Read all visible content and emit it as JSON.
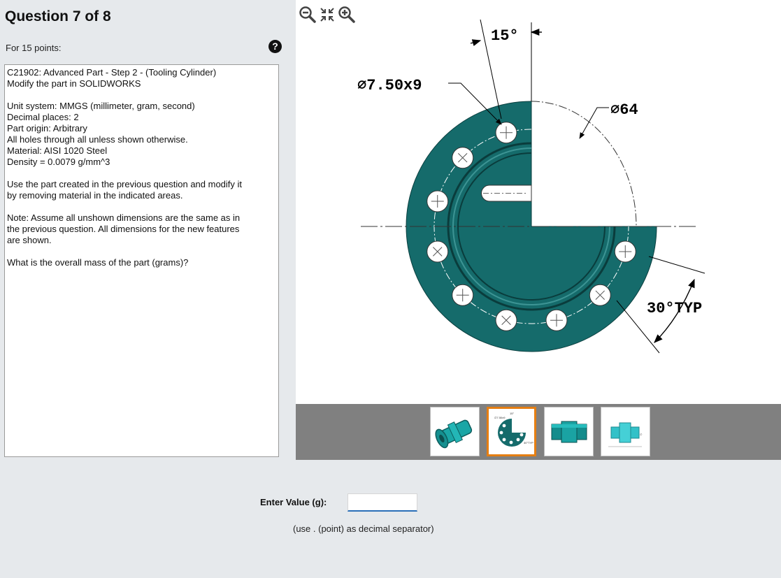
{
  "header": {
    "title": "Question 7 of 8",
    "points": "For 15 points:",
    "help_icon": "question-circle-icon"
  },
  "description": {
    "lines": [
      "C21902:  Advanced Part - Step 2 - (Tooling Cylinder)",
      "Modify the part in SOLIDWORKS",
      "",
      "Unit system: MMGS (millimeter, gram, second)",
      "Decimal places: 2",
      "Part origin: Arbitrary",
      "All holes through all unless shown otherwise.",
      "Material: AISI 1020 Steel",
      "Density = 0.0079 g/mm^3",
      "",
      "Use the part created in the previous question and modify it",
      "by removing material in the indicated areas.",
      "",
      "Note: Assume all unshown dimensions are the same as in",
      "the previous question.  All dimensions for the new features",
      "are shown.",
      "",
      "What is the overall mass of the part (grams)?"
    ]
  },
  "drawing": {
    "dim_angle": "15°",
    "dim_holes": "∅7.50x9",
    "dim_circle": "∅64",
    "dim_typ": "30°TYP",
    "part_color": "#156b6b"
  },
  "viewer": {
    "zoom_out_icon": "zoom-out-icon",
    "fit_icon": "fit-to-window-icon",
    "zoom_in_icon": "zoom-in-icon"
  },
  "thumbnails": [
    {
      "name": "isometric-view-thumbnail",
      "active": false
    },
    {
      "name": "front-view-thumbnail",
      "active": true
    },
    {
      "name": "side-view-thumbnail",
      "active": false
    },
    {
      "name": "detail-view-thumbnail",
      "active": false
    }
  ],
  "answer": {
    "label": "Enter Value (g):",
    "value": "",
    "hint": "(use . (point) as decimal separator)"
  }
}
